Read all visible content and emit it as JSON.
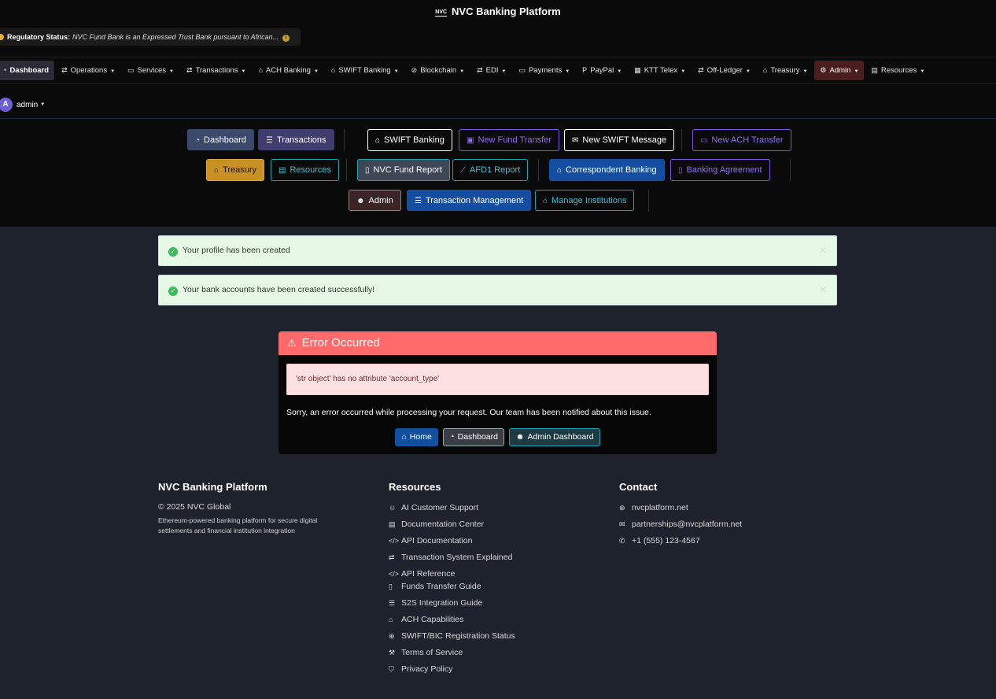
{
  "app": {
    "title": "NVC Banking Platform",
    "logo_text": "NVC"
  },
  "regulatory": {
    "label": "Regulatory Status:",
    "text": "NVC Fund Bank is an Expressed Trust Bank pursuant to African..."
  },
  "nav": [
    {
      "label": "Dashboard",
      "icon": "dashboard-icon"
    },
    {
      "label": "Operations",
      "icon": "exchange-icon"
    },
    {
      "label": "Services",
      "icon": "card-icon"
    },
    {
      "label": "Transactions",
      "icon": "exchange-icon"
    },
    {
      "label": "ACH Banking",
      "icon": "bank-icon"
    },
    {
      "label": "SWIFT Banking",
      "icon": "bank-icon"
    },
    {
      "label": "Blockchain",
      "icon": "link-icon"
    },
    {
      "label": "EDI",
      "icon": "exchange-icon"
    },
    {
      "label": "Payments",
      "icon": "card-icon"
    },
    {
      "label": "PayPal",
      "icon": "paypal-icon"
    },
    {
      "label": "KTT Telex",
      "icon": "building-icon"
    },
    {
      "label": "Off-Ledger",
      "icon": "exchange-icon"
    },
    {
      "label": "Treasury",
      "icon": "bank-icon"
    },
    {
      "label": "Admin",
      "icon": "gear-icon"
    },
    {
      "label": "Resources",
      "icon": "book-icon"
    }
  ],
  "user": {
    "initial": "A",
    "name": "admin"
  },
  "quick": {
    "dashboard": "Dashboard",
    "transactions": "Transactions",
    "swift_banking": "SWIFT Banking",
    "new_fund_transfer": "New Fund Transfer",
    "new_swift_message": "New SWIFT Message",
    "new_ach_transfer": "New ACH Transfer",
    "treasury": "Treasury",
    "resources": "Resources",
    "nvc_fund_report": "NVC Fund Report",
    "afd1_report": "AFD1 Report",
    "correspondent_banking": "Correspondent Banking",
    "banking_agreement": "Banking Agreement",
    "admin": "Admin",
    "transaction_management": "Transaction Management",
    "manage_institutions": "Manage Institutions"
  },
  "alerts": [
    "Your profile has been created",
    "Your bank accounts have been created successfully!"
  ],
  "error": {
    "title": "Error Occurred",
    "detail": "'str object' has no attribute 'account_type'",
    "message": "Sorry, an error occurred while processing your request. Our team has been notified about this issue.",
    "home": "Home",
    "dashboard": "Dashboard",
    "admin_dashboard": "Admin Dashboard"
  },
  "footer": {
    "brand_title": "NVC Banking Platform",
    "copyright": "© 2025 NVC Global",
    "description": "Ethereum-powered banking platform for secure digital settlements and financial institution integration",
    "resources_title": "Resources",
    "resources": [
      "AI Customer Support",
      "Documentation Center",
      "API Documentation",
      "Transaction System Explained",
      "API Reference",
      "Funds Transfer Guide",
      "S2S Integration Guide",
      "ACH Capabilities",
      "SWIFT/BIC Registration Status",
      "Terms of Service",
      "Privacy Policy"
    ],
    "contact_title": "Contact",
    "contact": [
      "nvcplatform.net",
      "partnerships@nvcplatform.net",
      "+1 (555) 123-4567"
    ]
  }
}
